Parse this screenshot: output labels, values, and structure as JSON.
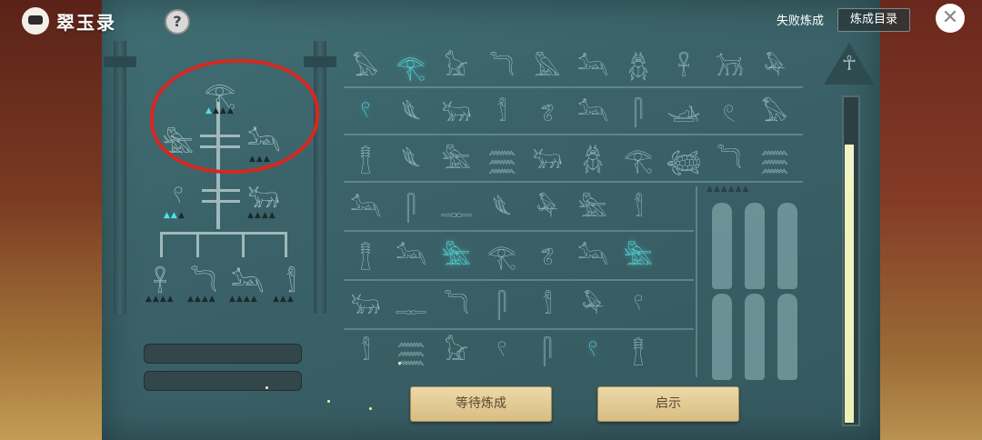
{
  "app": {
    "title": "翠玉录"
  },
  "topbar": {
    "help_icon": "?",
    "fail_label": "失败炼成",
    "catalog_label": "炼成目录",
    "close_icon": "✕"
  },
  "buttons": {
    "wait_label": "等待炼成",
    "hint_label": "启示"
  },
  "icons": {
    "row1": [
      "𓅃",
      "𓂀",
      "𓃠",
      "𓆓",
      "𓅓",
      "𓃢",
      "𓆣",
      "𓋹",
      "𓃡",
      "𓅆"
    ],
    "row2": [
      "𓍢",
      "𓆰",
      "𓃒",
      "𓀾",
      "𓆂",
      "𓃢",
      "𓋴",
      "𓊛",
      "𓏲",
      "𓅃"
    ],
    "row3": [
      "𓊽",
      "𓆰",
      "𓆲",
      "𓈗",
      "𓃒",
      "𓆣",
      "𓂀",
      "𓆉",
      "𓆓",
      "𓈗"
    ],
    "row4": [
      "𓃢",
      "𓋴",
      "𓊃",
      "𓆰",
      "𓅆",
      "𓆲",
      "𓀾"
    ],
    "row5": [
      "𓊽",
      "𓃢",
      "𓆲",
      "𓂀",
      "𓆂",
      "𓃢",
      "𓆲"
    ],
    "row6": [
      "𓃒",
      "𓊃",
      "𓆓",
      "𓋴",
      "𓀾",
      "𓅆",
      "𓍢"
    ],
    "row7": [
      "𓀾",
      "𓈗",
      "𓃠",
      "𓍢",
      "𓋴",
      "𓍢",
      "𓊽"
    ]
  },
  "tree": {
    "top": "𓂀",
    "left_mid": "𓆲",
    "right_mid": "𓃢",
    "ring": "𓍢",
    "animal": "𓃒",
    "bottom": [
      "𓋹",
      "𓆓",
      "𓃢",
      "𓀾"
    ]
  },
  "meter": {
    "level": 0.85
  },
  "colors": {
    "accent": "#5fe6e6",
    "panel": "#3a6268",
    "button": "#ecd8a8"
  }
}
